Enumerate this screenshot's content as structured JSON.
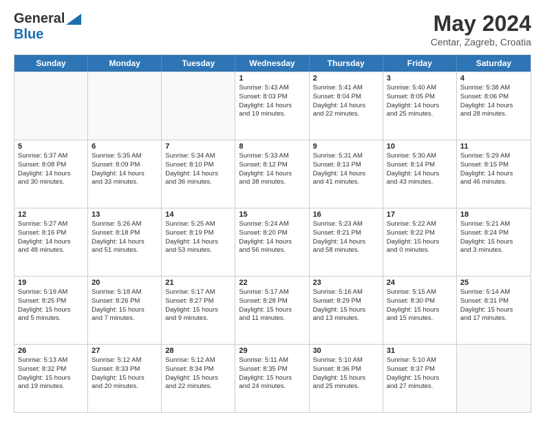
{
  "logo": {
    "line1": "General",
    "line2": "Blue"
  },
  "title": "May 2024",
  "subtitle": "Centar, Zagreb, Croatia",
  "weekdays": [
    "Sunday",
    "Monday",
    "Tuesday",
    "Wednesday",
    "Thursday",
    "Friday",
    "Saturday"
  ],
  "weeks": [
    [
      {
        "day": "",
        "info": ""
      },
      {
        "day": "",
        "info": ""
      },
      {
        "day": "",
        "info": ""
      },
      {
        "day": "1",
        "info": "Sunrise: 5:43 AM\nSunset: 8:03 PM\nDaylight: 14 hours\nand 19 minutes."
      },
      {
        "day": "2",
        "info": "Sunrise: 5:41 AM\nSunset: 8:04 PM\nDaylight: 14 hours\nand 22 minutes."
      },
      {
        "day": "3",
        "info": "Sunrise: 5:40 AM\nSunset: 8:05 PM\nDaylight: 14 hours\nand 25 minutes."
      },
      {
        "day": "4",
        "info": "Sunrise: 5:38 AM\nSunset: 8:06 PM\nDaylight: 14 hours\nand 28 minutes."
      }
    ],
    [
      {
        "day": "5",
        "info": "Sunrise: 5:37 AM\nSunset: 8:08 PM\nDaylight: 14 hours\nand 30 minutes."
      },
      {
        "day": "6",
        "info": "Sunrise: 5:35 AM\nSunset: 8:09 PM\nDaylight: 14 hours\nand 33 minutes."
      },
      {
        "day": "7",
        "info": "Sunrise: 5:34 AM\nSunset: 8:10 PM\nDaylight: 14 hours\nand 36 minutes."
      },
      {
        "day": "8",
        "info": "Sunrise: 5:33 AM\nSunset: 8:12 PM\nDaylight: 14 hours\nand 38 minutes."
      },
      {
        "day": "9",
        "info": "Sunrise: 5:31 AM\nSunset: 8:13 PM\nDaylight: 14 hours\nand 41 minutes."
      },
      {
        "day": "10",
        "info": "Sunrise: 5:30 AM\nSunset: 8:14 PM\nDaylight: 14 hours\nand 43 minutes."
      },
      {
        "day": "11",
        "info": "Sunrise: 5:29 AM\nSunset: 8:15 PM\nDaylight: 14 hours\nand 46 minutes."
      }
    ],
    [
      {
        "day": "12",
        "info": "Sunrise: 5:27 AM\nSunset: 8:16 PM\nDaylight: 14 hours\nand 48 minutes."
      },
      {
        "day": "13",
        "info": "Sunrise: 5:26 AM\nSunset: 8:18 PM\nDaylight: 14 hours\nand 51 minutes."
      },
      {
        "day": "14",
        "info": "Sunrise: 5:25 AM\nSunset: 8:19 PM\nDaylight: 14 hours\nand 53 minutes."
      },
      {
        "day": "15",
        "info": "Sunrise: 5:24 AM\nSunset: 8:20 PM\nDaylight: 14 hours\nand 56 minutes."
      },
      {
        "day": "16",
        "info": "Sunrise: 5:23 AM\nSunset: 8:21 PM\nDaylight: 14 hours\nand 58 minutes."
      },
      {
        "day": "17",
        "info": "Sunrise: 5:22 AM\nSunset: 8:22 PM\nDaylight: 15 hours\nand 0 minutes."
      },
      {
        "day": "18",
        "info": "Sunrise: 5:21 AM\nSunset: 8:24 PM\nDaylight: 15 hours\nand 3 minutes."
      }
    ],
    [
      {
        "day": "19",
        "info": "Sunrise: 5:19 AM\nSunset: 8:25 PM\nDaylight: 15 hours\nand 5 minutes."
      },
      {
        "day": "20",
        "info": "Sunrise: 5:18 AM\nSunset: 8:26 PM\nDaylight: 15 hours\nand 7 minutes."
      },
      {
        "day": "21",
        "info": "Sunrise: 5:17 AM\nSunset: 8:27 PM\nDaylight: 15 hours\nand 9 minutes."
      },
      {
        "day": "22",
        "info": "Sunrise: 5:17 AM\nSunset: 8:28 PM\nDaylight: 15 hours\nand 11 minutes."
      },
      {
        "day": "23",
        "info": "Sunrise: 5:16 AM\nSunset: 8:29 PM\nDaylight: 15 hours\nand 13 minutes."
      },
      {
        "day": "24",
        "info": "Sunrise: 5:15 AM\nSunset: 8:30 PM\nDaylight: 15 hours\nand 15 minutes."
      },
      {
        "day": "25",
        "info": "Sunrise: 5:14 AM\nSunset: 8:31 PM\nDaylight: 15 hours\nand 17 minutes."
      }
    ],
    [
      {
        "day": "26",
        "info": "Sunrise: 5:13 AM\nSunset: 8:32 PM\nDaylight: 15 hours\nand 19 minutes."
      },
      {
        "day": "27",
        "info": "Sunrise: 5:12 AM\nSunset: 8:33 PM\nDaylight: 15 hours\nand 20 minutes."
      },
      {
        "day": "28",
        "info": "Sunrise: 5:12 AM\nSunset: 8:34 PM\nDaylight: 15 hours\nand 22 minutes."
      },
      {
        "day": "29",
        "info": "Sunrise: 5:11 AM\nSunset: 8:35 PM\nDaylight: 15 hours\nand 24 minutes."
      },
      {
        "day": "30",
        "info": "Sunrise: 5:10 AM\nSunset: 8:36 PM\nDaylight: 15 hours\nand 25 minutes."
      },
      {
        "day": "31",
        "info": "Sunrise: 5:10 AM\nSunset: 8:37 PM\nDaylight: 15 hours\nand 27 minutes."
      },
      {
        "day": "",
        "info": ""
      }
    ]
  ]
}
